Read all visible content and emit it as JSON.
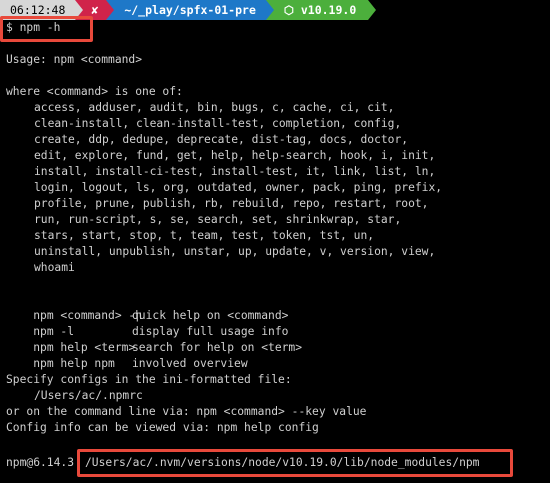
{
  "prompt": {
    "time": "06:12:48",
    "status": "✘",
    "path": "~/_play/spfx-01-pre",
    "node_icon": "hexagon-icon",
    "node_version": "v10.19.0",
    "segment_colors": {
      "time": "#d7d7d7",
      "status": "#d0234a",
      "path": "#1e78c8",
      "node": "#4caf3c"
    }
  },
  "command": "$ npm -h",
  "highlight_color": "#e8493b",
  "output": {
    "usage": "Usage: npm <command>",
    "where_intro": "where <command> is one of:",
    "command_lines": [
      "access, adduser, audit, bin, bugs, c, cache, ci, cit,",
      "clean-install, clean-install-test, completion, config,",
      "create, ddp, dedupe, deprecate, dist-tag, docs, doctor,",
      "edit, explore, fund, get, help, help-search, hook, i, init,",
      "install, install-ci-test, install-test, it, link, list, ln,",
      "login, logout, ls, org, outdated, owner, pack, ping, prefix,",
      "profile, prune, publish, rb, rebuild, repo, restart, root,",
      "run, run-script, s, se, search, set, shrinkwrap, star,",
      "stars, start, stop, t, team, test, token, tst, un,",
      "uninstall, unpublish, unstar, up, update, v, version, view,",
      "whoami"
    ],
    "help_rows": [
      {
        "cmd": "npm <command> -h",
        "desc": "quick help on <command>"
      },
      {
        "cmd": "npm -l",
        "desc": "display full usage info"
      },
      {
        "cmd": "npm help <term>",
        "desc": "search for help on <term>"
      },
      {
        "cmd": "npm help npm",
        "desc": "involved overview"
      }
    ],
    "configs_intro": "Specify configs in the ini-formatted file:",
    "configs_path": "/Users/ac/.npmrc",
    "cli_line": "or on the command line via: npm <command> --key value",
    "config_info": "Config info can be viewed via: npm help config",
    "version_prefix": "npm@6.14.3",
    "install_path": "/Users/ac/.nvm/versions/node/v10.19.0/lib/node_modules/npm"
  }
}
